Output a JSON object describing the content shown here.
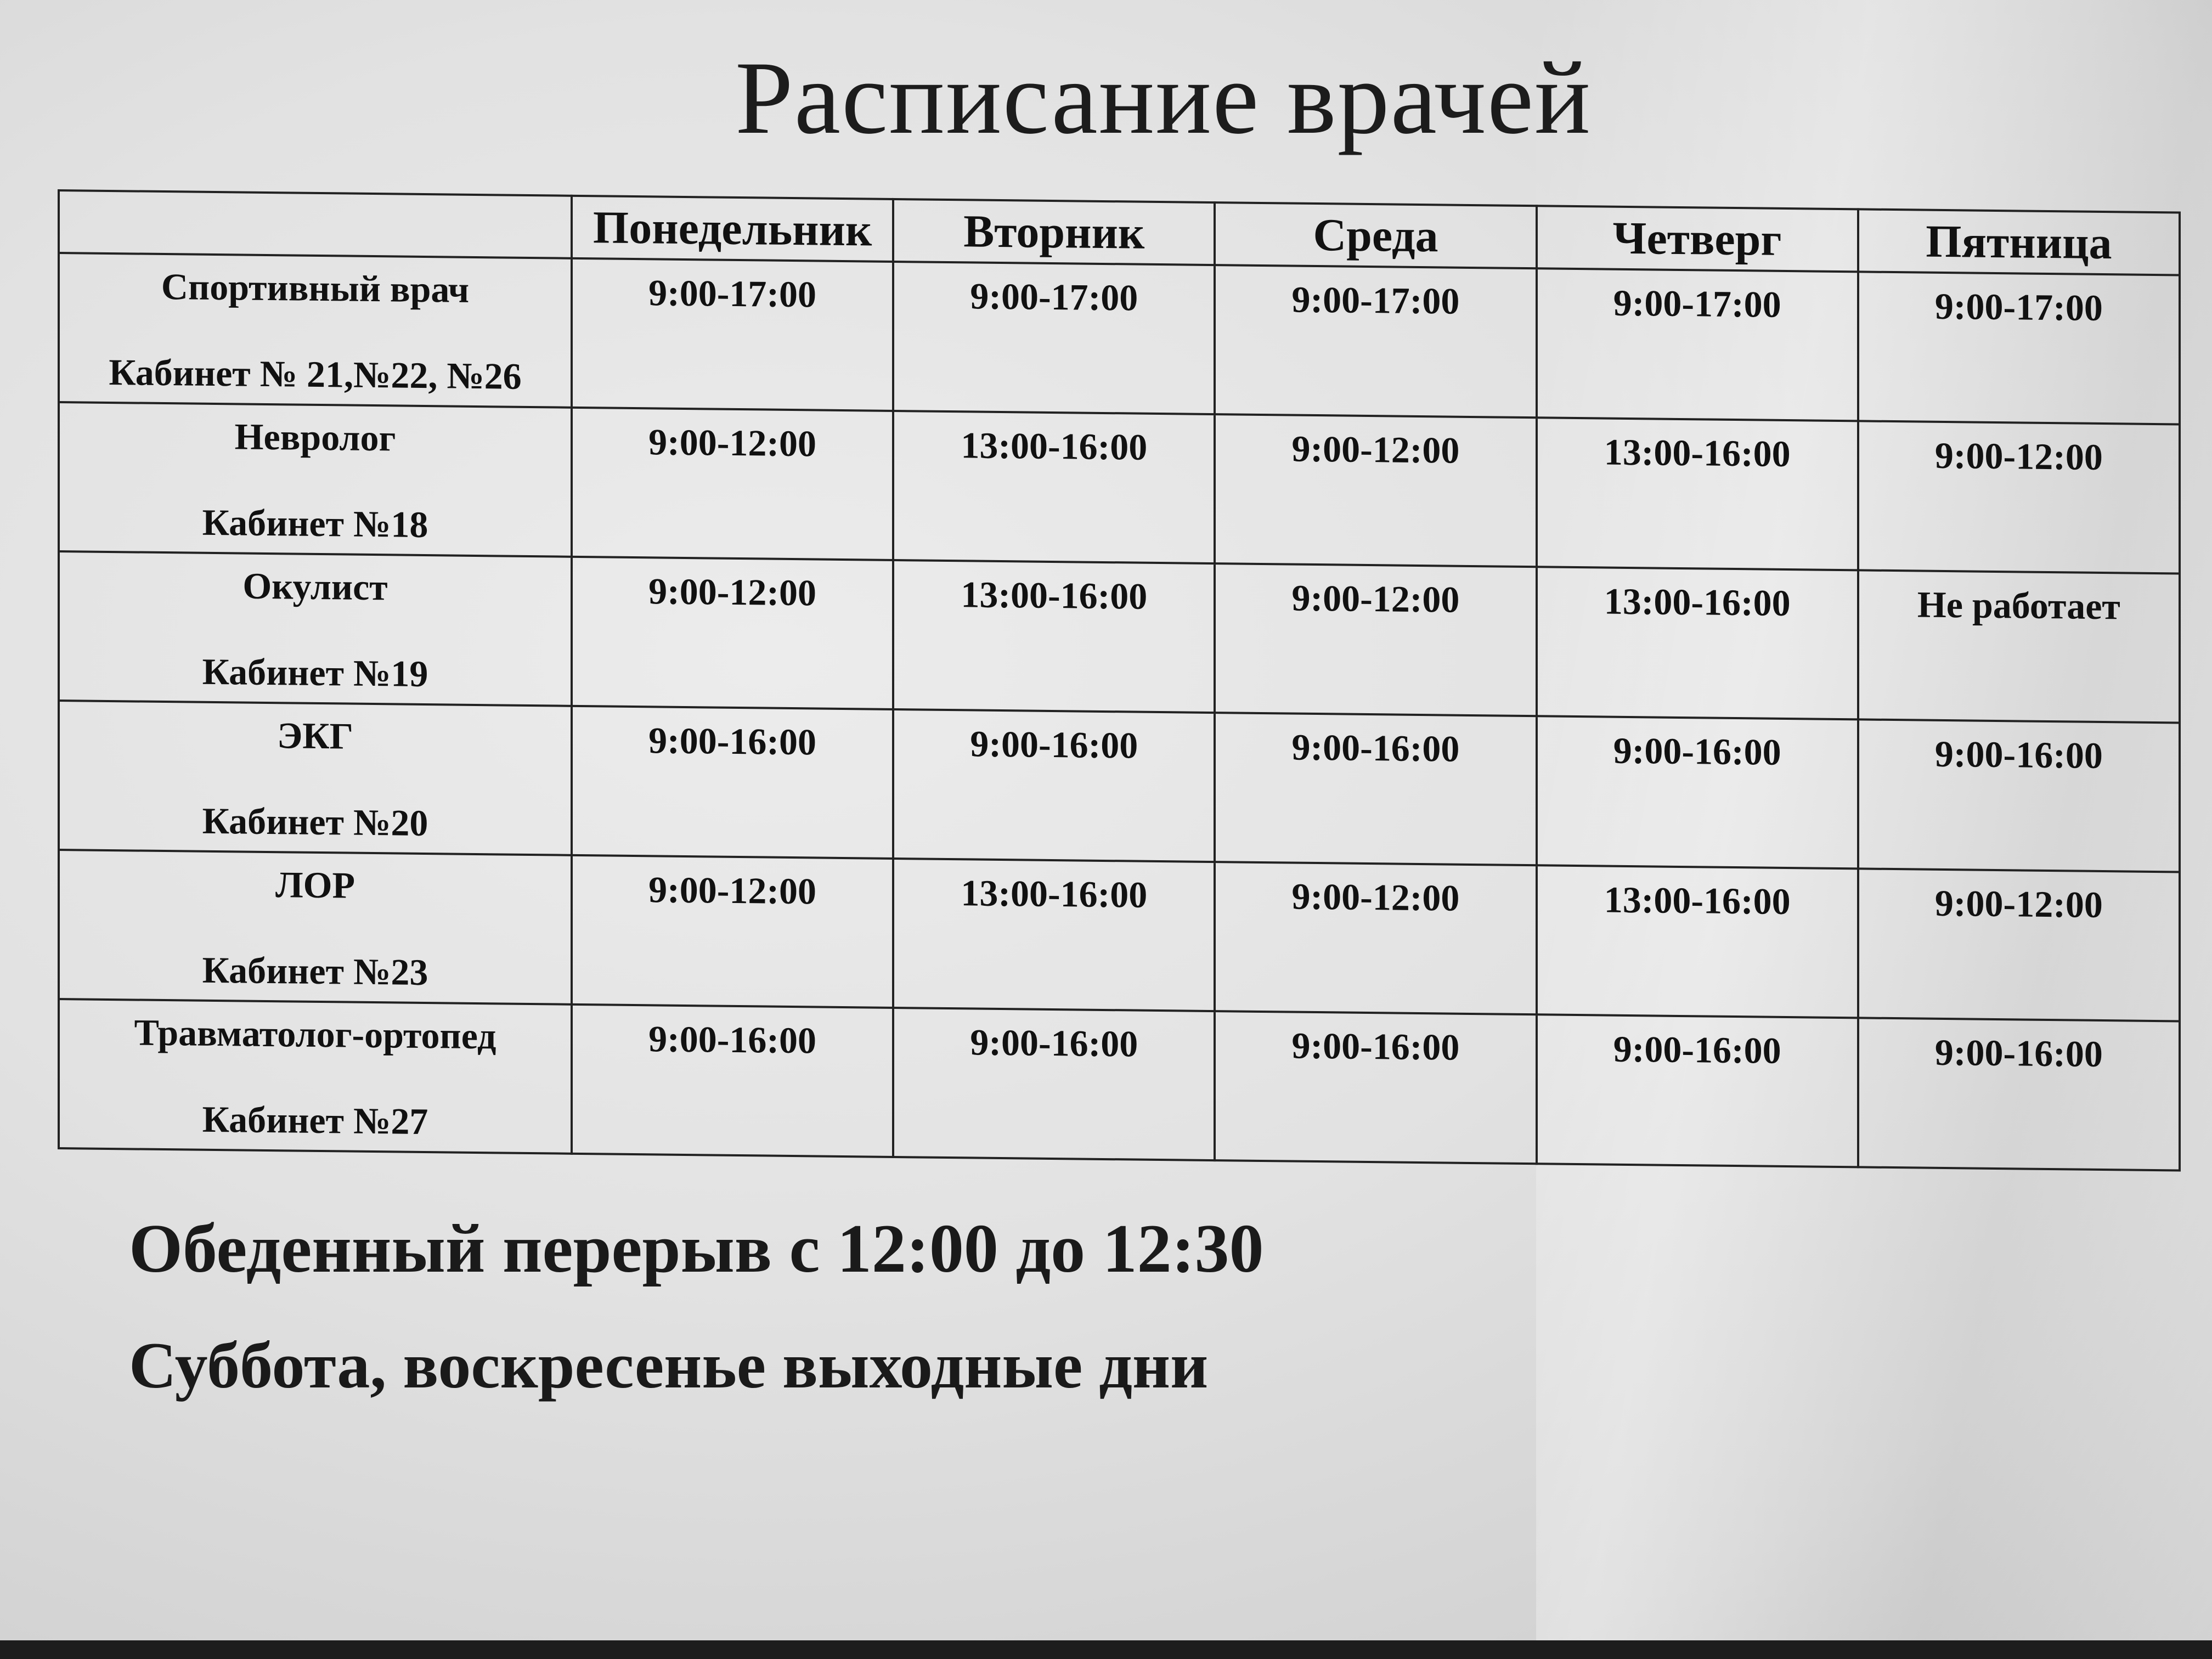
{
  "title": "Расписание врачей",
  "table": {
    "days": [
      "Понедельник",
      "Вторник",
      "Среда",
      "Четверг",
      "Пятница"
    ],
    "rows": [
      {
        "doctor": "Спортивный врач",
        "room": "Кабинет № 21,№22, №26",
        "times": [
          "9:00-17:00",
          "9:00-17:00",
          "9:00-17:00",
          "9:00-17:00",
          "9:00-17:00"
        ]
      },
      {
        "doctor": "Невролог",
        "room": "Кабинет №18",
        "times": [
          "9:00-12:00",
          "13:00-16:00",
          "9:00-12:00",
          "13:00-16:00",
          "9:00-12:00"
        ]
      },
      {
        "doctor": "Окулист",
        "room": "Кабинет №19",
        "times": [
          "9:00-12:00",
          "13:00-16:00",
          "9:00-12:00",
          "13:00-16:00",
          "Не работает"
        ]
      },
      {
        "doctor": "ЭКГ",
        "room": "Кабинет №20",
        "times": [
          "9:00-16:00",
          "9:00-16:00",
          "9:00-16:00",
          "9:00-16:00",
          "9:00-16:00"
        ]
      },
      {
        "doctor": "ЛОР",
        "room": "Кабинет №23",
        "times": [
          "9:00-12:00",
          "13:00-16:00",
          "9:00-12:00",
          "13:00-16:00",
          "9:00-12:00"
        ]
      },
      {
        "doctor": "Травматолог-ортопед",
        "room": "Кабинет №27",
        "times": [
          "9:00-16:00",
          "9:00-16:00",
          "9:00-16:00",
          "9:00-16:00",
          "9:00-16:00"
        ]
      }
    ]
  },
  "notes": {
    "lunch": "Обеденный перерыв с 12:00 до 12:30",
    "weekend": "Суббота, воскресенье выходные дни"
  }
}
